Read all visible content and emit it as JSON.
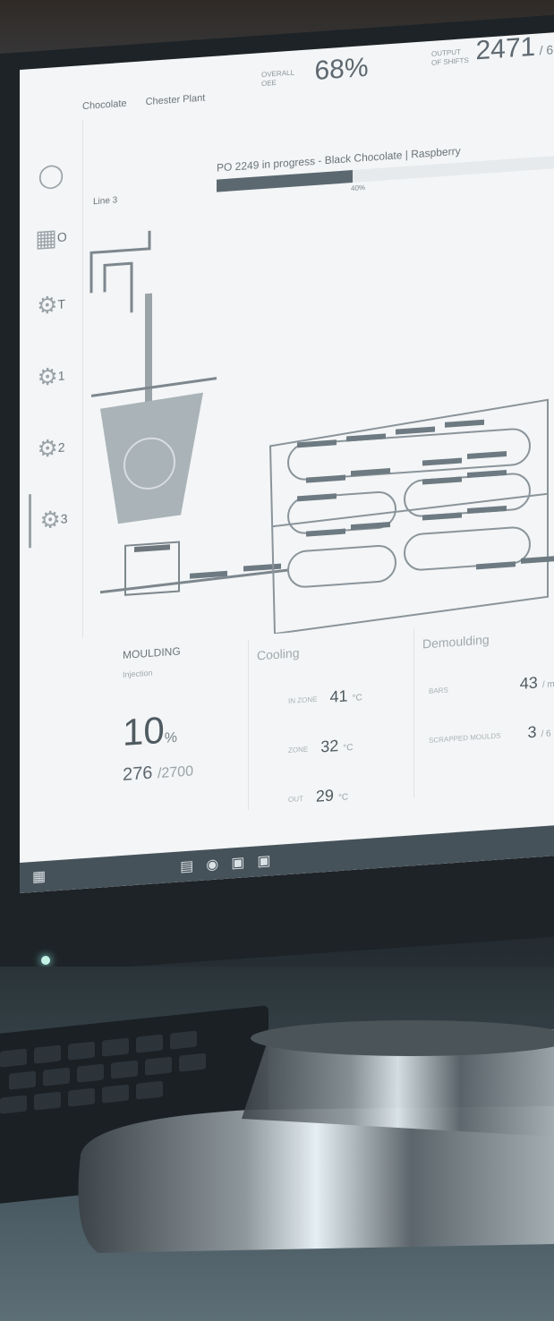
{
  "header": {
    "breadcrumb": [
      "Chocolate",
      "Chester Plant"
    ],
    "kpi_oee_label": "OVERALL OEE",
    "kpi_oee_value": "68%",
    "kpi_count_label": "OUTPUT OF SHIFTS",
    "kpi_count_value": "2471",
    "kpi_count_suffix": "/ 6"
  },
  "production_order": {
    "text": "PO 2249 in progress - Black Chocolate | Raspberry",
    "progress_percent": 40,
    "progress_label": "40%"
  },
  "sidebar": {
    "items": [
      {
        "icon": "chocolate-icon",
        "sub": ""
      },
      {
        "icon": "grid-icon",
        "sub": "O"
      },
      {
        "icon": "gears-icon",
        "sub": "T"
      },
      {
        "icon": "gears-icon",
        "sub": "1"
      },
      {
        "icon": "gears-icon",
        "sub": "2"
      },
      {
        "icon": "gears-icon",
        "sub": "3"
      }
    ]
  },
  "line": {
    "label": "Line 3"
  },
  "moulding": {
    "title": "MOULDING",
    "subtitle": "Injection",
    "percent": "10",
    "percent_unit": "%",
    "count": "276",
    "count_total": "/2700"
  },
  "cooling": {
    "title": "Cooling",
    "rows": [
      {
        "label": "IN ZONE",
        "value": "41",
        "unit": "°C"
      },
      {
        "label": "ZONE",
        "value": "32",
        "unit": "°C"
      },
      {
        "label": "OUT",
        "value": "29",
        "unit": "°C"
      }
    ]
  },
  "demoulding": {
    "title": "Demoulding",
    "rows": [
      {
        "label": "BARS",
        "value": "43",
        "unit": "/ m"
      },
      {
        "label": "SCRAPPED MOULDS",
        "value": "3",
        "unit": "/ 6"
      }
    ]
  },
  "colors": {
    "screen": "#f3f5f6",
    "accent": "#5b6870",
    "taskbar": "#46525a"
  }
}
